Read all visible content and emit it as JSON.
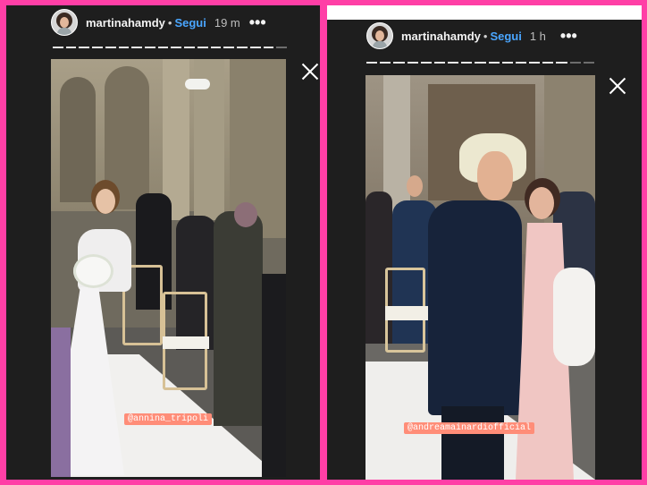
{
  "stories": [
    {
      "username": "martinahamdy",
      "separator": "•",
      "follow_label": "Segui",
      "time": "19 m",
      "more_icon": "•••",
      "mention": "@annina_tripoli"
    },
    {
      "username": "martinahamdy",
      "separator": "•",
      "follow_label": "Segui",
      "time": "1 h",
      "more_icon": "•••",
      "mention": "@andreamainardiofficial"
    }
  ],
  "colors": {
    "page_border": "#ff3fa6",
    "panel_bg": "#1e1e1e",
    "follow": "#4aa6ff",
    "mention_bg": "#ff8d78"
  }
}
